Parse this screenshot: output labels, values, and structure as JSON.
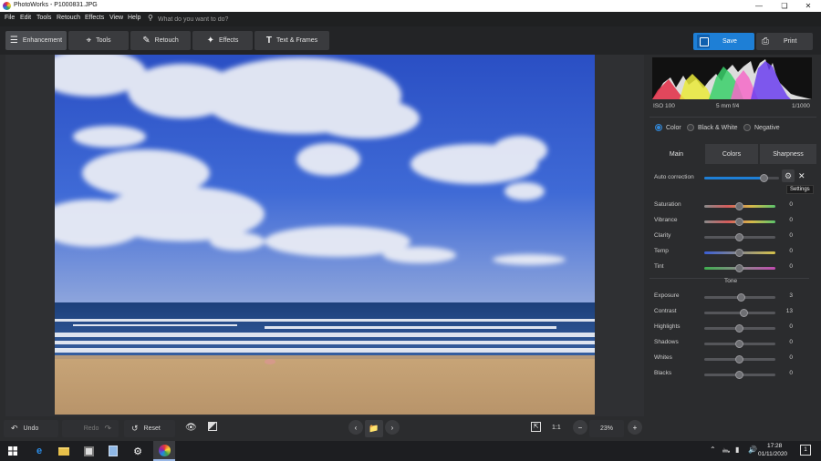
{
  "window": {
    "title": "PhotoWorks - P1000831.JPG"
  },
  "menu": {
    "items": [
      "File",
      "Edit",
      "Tools",
      "Retouch",
      "Effects",
      "View",
      "Help"
    ],
    "search_placeholder": "What do you want to do?"
  },
  "toolbar": {
    "tabs": [
      {
        "label": "Enhancement",
        "icon": "sliders-icon",
        "active": true
      },
      {
        "label": "Tools",
        "icon": "crop-icon"
      },
      {
        "label": "Retouch",
        "icon": "brush-icon"
      },
      {
        "label": "Effects",
        "icon": "magic-wand-icon"
      },
      {
        "label": "Text & Frames",
        "icon": "text-icon"
      }
    ],
    "save_label": "Save",
    "print_label": "Print"
  },
  "bottombar": {
    "undo_label": "Undo",
    "redo_label": "Redo",
    "reset_label": "Reset",
    "ratio_label": "1:1",
    "zoom_label": "23%"
  },
  "panel": {
    "exif": {
      "iso": "ISO 100",
      "lens": "5 mm f/4",
      "shutter": "1/1000"
    },
    "modes": [
      {
        "label": "Color",
        "selected": true
      },
      {
        "label": "Black & White",
        "selected": false
      },
      {
        "label": "Negative",
        "selected": false
      }
    ],
    "tabs": [
      "Main",
      "Colors",
      "Sharpness"
    ],
    "auto_correction_label": "Auto correction",
    "auto_correction_level": 0.8,
    "tooltip": "Settings",
    "color_sliders": [
      {
        "label": "Saturation",
        "value": "0",
        "level": 0.5
      },
      {
        "label": "Vibrance",
        "value": "0",
        "level": 0.5
      },
      {
        "label": "Clarity",
        "value": "0",
        "level": 0.5
      },
      {
        "label": "Temp",
        "value": "0",
        "level": 0.5
      },
      {
        "label": "Tint",
        "value": "0",
        "level": 0.5
      }
    ],
    "tone_header": "Tone",
    "tone_sliders": [
      {
        "label": "Exposure",
        "value": "3",
        "level": 0.52
      },
      {
        "label": "Contrast",
        "value": "13",
        "level": 0.57
      },
      {
        "label": "Highlights",
        "value": "0",
        "level": 0.5
      },
      {
        "label": "Shadows",
        "value": "0",
        "level": 0.5
      },
      {
        "label": "Whites",
        "value": "0",
        "level": 0.5
      },
      {
        "label": "Blacks",
        "value": "0",
        "level": 0.5
      }
    ]
  },
  "taskbar": {
    "time": "17:28",
    "date": "01/11/2020",
    "notification_count": "1"
  },
  "colors": {
    "accent": "#1e7fd6",
    "panel_bg": "#2b2c2e"
  }
}
